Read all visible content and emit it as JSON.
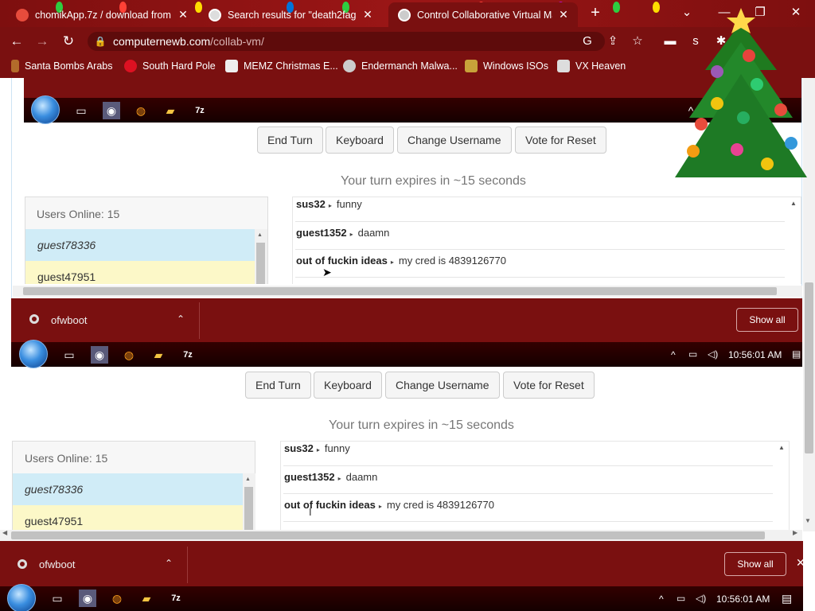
{
  "browser": {
    "tabs": [
      {
        "title": "chomikApp.7z / download from",
        "active": false
      },
      {
        "title": "Search results for \"death2fags\" -",
        "active": false
      },
      {
        "title": "Control Collaborative Virtual Ma",
        "active": true
      }
    ],
    "new_tab": "+",
    "url_host": "computernewb.com",
    "url_path": "/collab-vm/",
    "bookmarks": [
      "Santa Bombs Arabs",
      "South Hard Pole",
      "MEMZ Christmas E...",
      "Endermanch Malwa...",
      "Windows ISOs",
      "VX Heaven"
    ]
  },
  "vm": {
    "buttons": {
      "end_turn": "End Turn",
      "keyboard": "Keyboard",
      "change_username": "Change Username",
      "vote_reset": "Vote for Reset"
    },
    "turn_text": "Your turn expires in ~15 seconds",
    "users_header": "Users Online: 15",
    "users": [
      "guest78336",
      "guest47951"
    ],
    "chat": [
      {
        "user": "sus32",
        "text": "funny"
      },
      {
        "user": "guest1352",
        "text": "daamn"
      },
      {
        "user": "out of fuckin ideas",
        "text": "my cred is 4839126770"
      }
    ]
  },
  "download_bar": {
    "item": "ofwboot",
    "show_all": "Show all"
  },
  "taskbar": {
    "time": "10:56:01 AM"
  },
  "colors": {
    "chrome_red": "#7a1010",
    "user_blue": "#d0ecf7",
    "user_yellow": "#fcf8c8"
  }
}
